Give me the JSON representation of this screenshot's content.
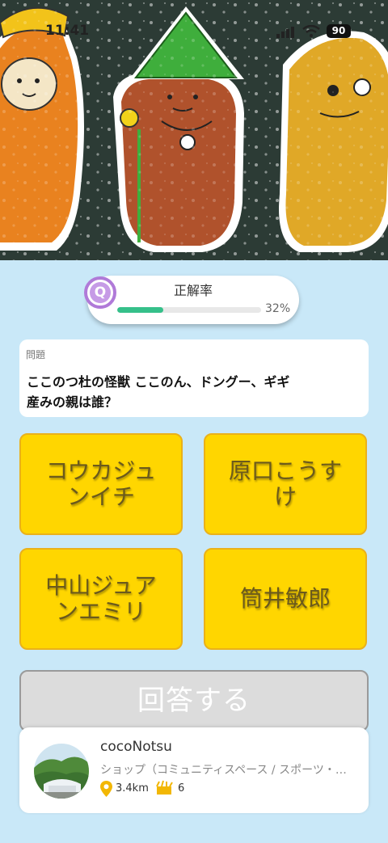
{
  "status_bar": {
    "time": "11:41",
    "battery": "90"
  },
  "quiz": {
    "badge": "Q",
    "rate_label": "正解率",
    "rate_text": "32%",
    "rate_value": 0.32
  },
  "question": {
    "label": "問題",
    "line1": "ここのつ杜の怪獣 ここのん、ドングー、ギギ",
    "line2": "産みの親は誰？"
  },
  "choices": [
    "コウカジュンイチ",
    "原口こうすけ",
    "中山ジュアンエミリ",
    "筒井敏郎"
  ],
  "answer_button": "回答する",
  "shop": {
    "name": "cocoNotsu",
    "category": "ショップ（コミュニティスペース / スポーツ・…",
    "distance": "3.4km",
    "visits": "6"
  },
  "colors": {
    "background": "#c9e8f8",
    "choice": "#ffd600",
    "progress": "#35c08a",
    "badge": "#b07ad8",
    "pin": "#f2b705"
  }
}
